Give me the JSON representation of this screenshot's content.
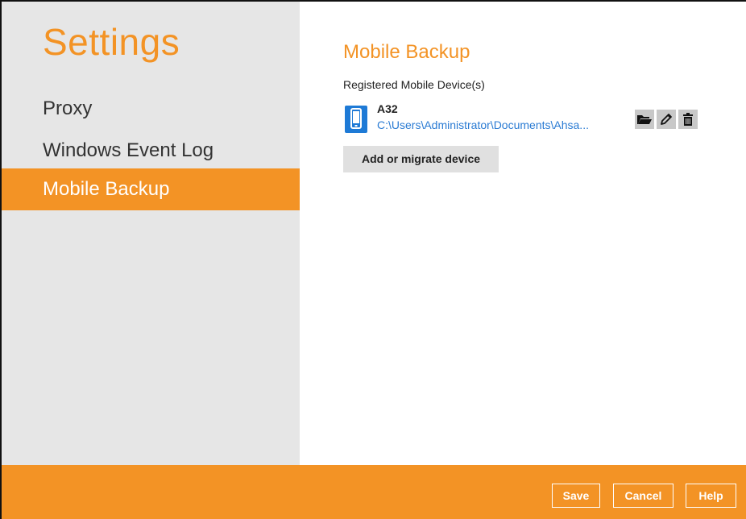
{
  "sidebar": {
    "title": "Settings",
    "items": [
      {
        "label": "Proxy",
        "active": false
      },
      {
        "label": "Windows Event Log",
        "active": false
      },
      {
        "label": "Mobile Backup",
        "active": true
      }
    ]
  },
  "main": {
    "title": "Mobile Backup",
    "section_label": "Registered Mobile Device(s)",
    "devices": [
      {
        "name": "A32",
        "path": "C:\\Users\\Administrator\\Documents\\Ahsa...",
        "icon": "mobile-phone-icon",
        "actions": [
          "folder-open-icon",
          "pencil-icon",
          "trash-icon"
        ]
      }
    ],
    "add_button_label": "Add or migrate device"
  },
  "footer": {
    "save_label": "Save",
    "cancel_label": "Cancel",
    "help_label": "Help"
  },
  "colors": {
    "accent": "#f39325",
    "sidebar_bg": "#e6e6e6",
    "link": "#2a7bd3",
    "device_icon": "#1e7ad6"
  }
}
